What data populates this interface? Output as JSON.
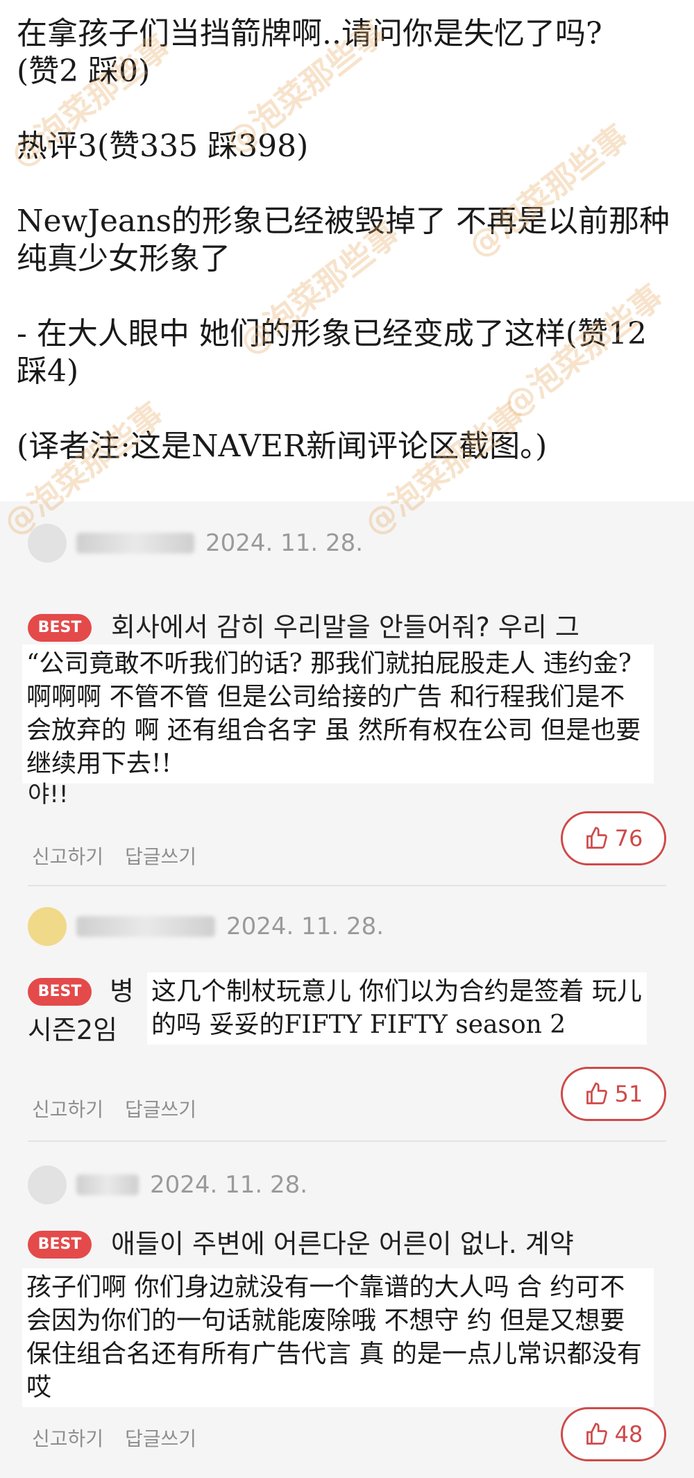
{
  "post": {
    "line1": "在拿孩子们当挡箭牌啊..请问你是失忆了吗?",
    "line2": "(赞2 踩0)",
    "hot3": "热评3(赞335 踩398)",
    "para3": "NewJeans的形象已经被毁掉了 不再是以前那种纯真少女形象了",
    "para4": "- 在大人眼中 她们的形象已经变成了这样(赞12 踩4)",
    "note": "(译者注:这是NAVER新闻评论区截图。)"
  },
  "watermark": "@泡菜那些事",
  "comments": [
    {
      "date": "2024. 11. 28.",
      "badge": "BEST",
      "korean": "회사에서 감히 우리말을 안들어줘? 우리 그",
      "chinese": "“公司竟敢不听我们的话? 那我们就拍屁股走人 违约金? 啊啊啊 不管不管 但是公司给接的广告 和行程我们是不会放弃的 啊 还有组合名字 虽 然所有权在公司 但是也要继续用下去!!",
      "tail": "야!!",
      "report": "신고하기",
      "reply": "답글쓰기",
      "likes": "76"
    },
    {
      "date": "2024. 11. 28.",
      "badge": "BEST",
      "korean": "병",
      "korean2": "시즌2임",
      "chinese": "这几个制杖玩意儿 你们以为合约是签着 玩儿的吗 妥妥的FIFTY FIFTY season 2",
      "report": "신고하기",
      "reply": "답글쓰기",
      "likes": "51"
    },
    {
      "date": "2024. 11. 28.",
      "badge": "BEST",
      "korean": "애들이 주변에 어른다운 어른이 없나. 계약",
      "chinese": "孩子们啊 你们身边就没有一个靠谱的大人吗 合 约可不会因为你们的一句话就能废除哦 不想守 约 但是又想要保住组合名还有所有广告代言 真 的是一点儿常识都没有哎",
      "report": "신고하기",
      "reply": "답글쓰기",
      "likes": "48"
    }
  ],
  "icons": {
    "like": "thumbs-up-icon",
    "avatar": "avatar-icon"
  },
  "colors": {
    "best": "#e44a4a",
    "like_border": "#cf4a4a",
    "bg": "#f5f5f5",
    "watermark": "#e8b06e"
  }
}
